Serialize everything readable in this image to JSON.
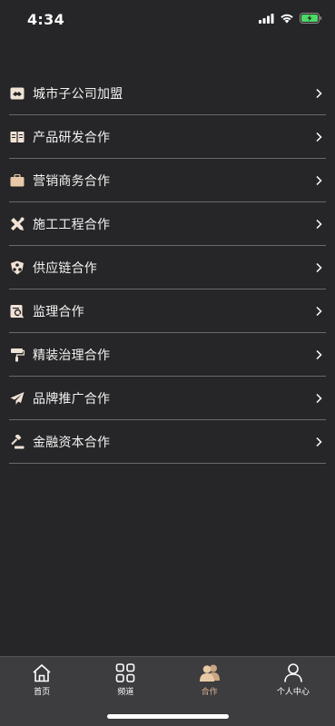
{
  "status_bar": {
    "time": "4:34"
  },
  "colors": {
    "background": "#262527",
    "accent": "#d7b291",
    "tab_bar": "#3d3c3e",
    "battery": "#4cd964"
  },
  "menu": {
    "items": [
      {
        "label": "城市子公司加盟",
        "icon": "handshake-icon"
      },
      {
        "label": "产品研发合作",
        "icon": "book-icon"
      },
      {
        "label": "营销商务合作",
        "icon": "briefcase-icon"
      },
      {
        "label": "施工工程合作",
        "icon": "tools-icon"
      },
      {
        "label": "供应链合作",
        "icon": "supply-chain-icon"
      },
      {
        "label": "监理合作",
        "icon": "inspection-icon"
      },
      {
        "label": "精装治理合作",
        "icon": "paint-roller-icon"
      },
      {
        "label": "品牌推广合作",
        "icon": "paper-plane-icon"
      },
      {
        "label": "金融资本合作",
        "icon": "gavel-icon"
      }
    ]
  },
  "tab_bar": {
    "tabs": [
      {
        "label": "首页",
        "icon": "home-icon"
      },
      {
        "label": "频道",
        "icon": "grid-icon"
      },
      {
        "label": "合作",
        "icon": "people-icon",
        "active": true
      },
      {
        "label": "个人中心",
        "icon": "person-icon"
      }
    ]
  }
}
